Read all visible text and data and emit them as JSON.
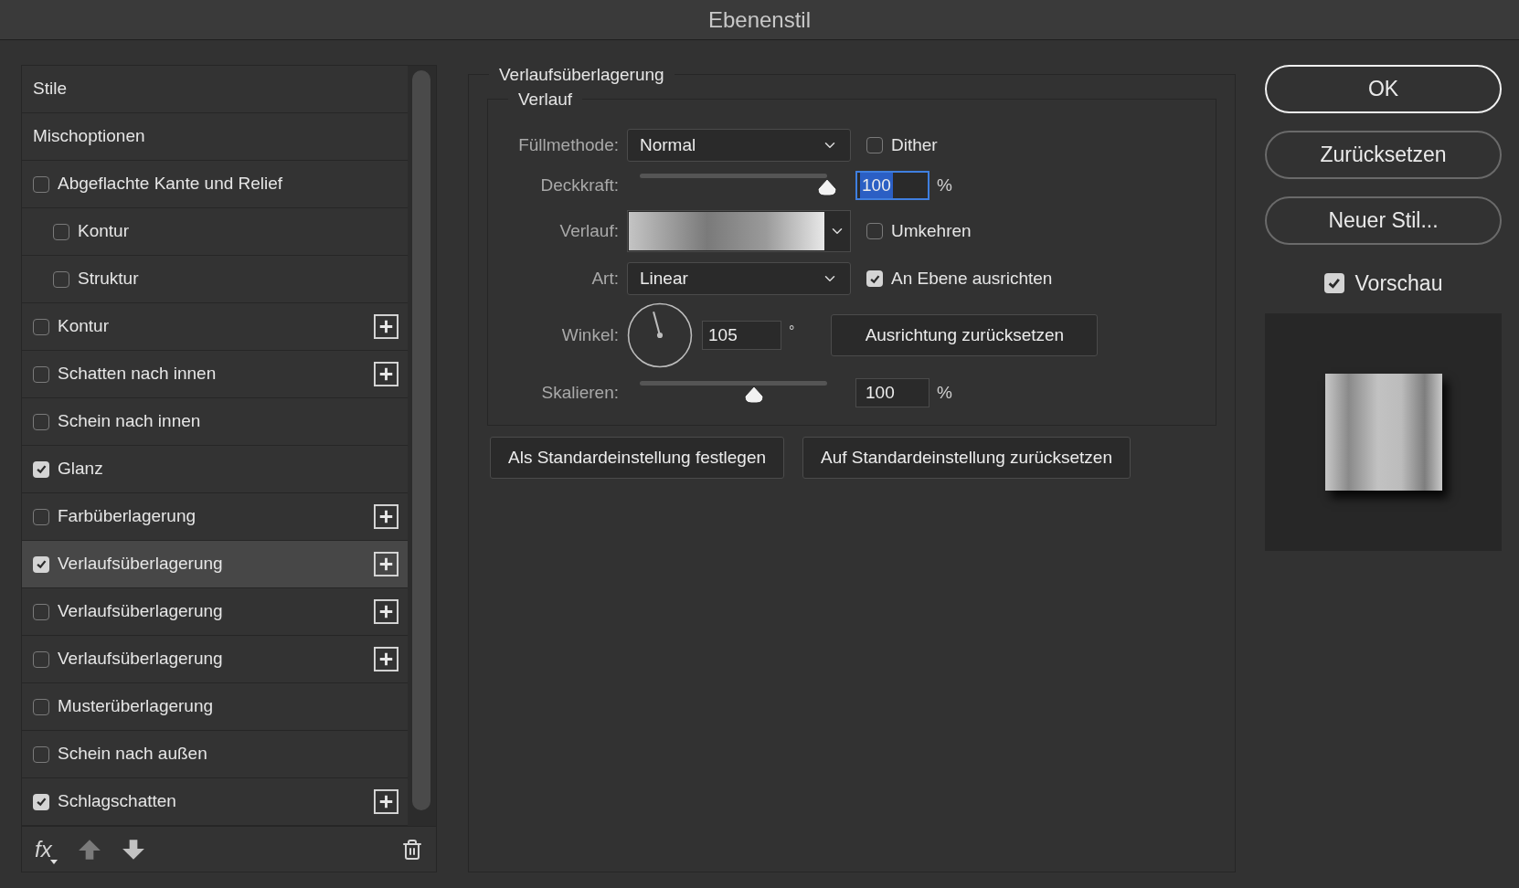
{
  "window": {
    "title": "Ebenenstil"
  },
  "style_list": {
    "items": [
      {
        "kind": "header",
        "label": "Stile",
        "selected": false
      },
      {
        "kind": "header",
        "label": "Mischoptionen",
        "selected": false
      },
      {
        "kind": "effect",
        "label": "Abgeflachte Kante und Relief",
        "checked": false,
        "addable": false,
        "selected": false,
        "children": [
          {
            "kind": "effect",
            "label": "Kontur",
            "checked": false,
            "addable": false,
            "selected": false
          },
          {
            "kind": "effect",
            "label": "Struktur",
            "checked": false,
            "addable": false,
            "selected": false
          }
        ]
      },
      {
        "kind": "effect",
        "label": "Kontur",
        "checked": false,
        "addable": true,
        "selected": false
      },
      {
        "kind": "effect",
        "label": "Schatten nach innen",
        "checked": false,
        "addable": true,
        "selected": false
      },
      {
        "kind": "effect",
        "label": "Schein nach innen",
        "checked": false,
        "addable": false,
        "selected": false
      },
      {
        "kind": "effect",
        "label": "Glanz",
        "checked": true,
        "addable": false,
        "selected": false
      },
      {
        "kind": "effect",
        "label": "Farbüberlagerung",
        "checked": false,
        "addable": true,
        "selected": false
      },
      {
        "kind": "effect",
        "label": "Verlaufsüberlagerung",
        "checked": true,
        "addable": true,
        "selected": true
      },
      {
        "kind": "effect",
        "label": "Verlaufsüberlagerung",
        "checked": false,
        "addable": true,
        "selected": false
      },
      {
        "kind": "effect",
        "label": "Verlaufsüberlagerung",
        "checked": false,
        "addable": true,
        "selected": false
      },
      {
        "kind": "effect",
        "label": "Musterüberlagerung",
        "checked": false,
        "addable": false,
        "selected": false
      },
      {
        "kind": "effect",
        "label": "Schein nach außen",
        "checked": false,
        "addable": false,
        "selected": false
      },
      {
        "kind": "effect",
        "label": "Schlagschatten",
        "checked": true,
        "addable": true,
        "selected": false
      }
    ]
  },
  "toolbar": {
    "effects_label": "fx"
  },
  "panel": {
    "title": "Verlaufsüberlagerung",
    "section": {
      "title": "Verlauf",
      "blend_mode": {
        "label": "Füllmethode:",
        "value": "Normal"
      },
      "dither": {
        "label": "Dither",
        "checked": false
      },
      "opacity": {
        "label": "Deckkraft:",
        "level": 1,
        "value": "100",
        "unit": "%",
        "focused": true
      },
      "gradient": {
        "label": "Verlauf:"
      },
      "reverse": {
        "label": "Umkehren",
        "checked": false
      },
      "style": {
        "label": "Art:",
        "value": "Linear"
      },
      "align": {
        "label": "An Ebene ausrichten",
        "checked": true
      },
      "angle": {
        "label": "Winkel:",
        "value": "105",
        "unit": "°"
      },
      "reset_alignment": "Ausrichtung zurücksetzen",
      "scale": {
        "label": "Skalieren:",
        "level": 0.61,
        "value": "100",
        "unit": "%"
      }
    },
    "buttons": [
      "Als Standardeinstellung festlegen",
      "Auf Standardeinstellung zurücksetzen"
    ]
  },
  "actions": [
    {
      "label": "OK",
      "default": true
    },
    {
      "label": "Zurücksetzen",
      "default": false
    },
    {
      "label": "Neuer Stil...",
      "default": false
    }
  ],
  "preview": {
    "label": "Vorschau",
    "checked": true
  }
}
